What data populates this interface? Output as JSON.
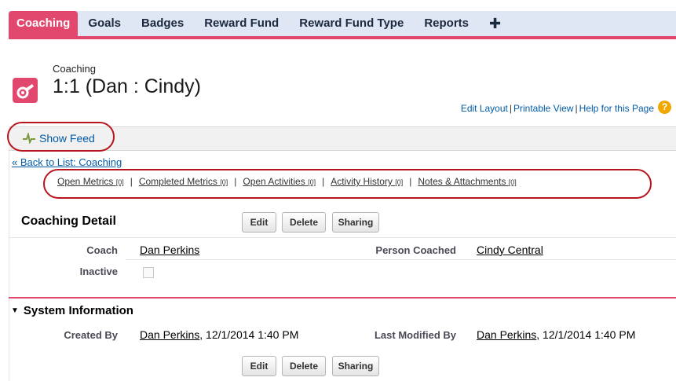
{
  "tabs": [
    {
      "label": "Coaching",
      "active": true
    },
    {
      "label": "Goals"
    },
    {
      "label": "Badges"
    },
    {
      "label": "Reward Fund"
    },
    {
      "label": "Reward Fund Type"
    },
    {
      "label": "Reports"
    },
    {
      "label": "✚"
    }
  ],
  "header": {
    "object_label": "Coaching",
    "record_title": "1:1 (Dan : Cindy)",
    "icon": "whistle-icon"
  },
  "help_links": {
    "edit_layout": "Edit Layout",
    "printable_view": "Printable View",
    "help": "Help for this Page",
    "help_icon": "?"
  },
  "feed": {
    "label": "Show Feed",
    "icon": "feed-pulse-icon"
  },
  "back_link": "« Back to List: Coaching",
  "related_lists": [
    {
      "label": "Open Metrics",
      "count": "[0]"
    },
    {
      "label": "Completed Metrics",
      "count": "[0]"
    },
    {
      "label": "Open Activities",
      "count": "[0]"
    },
    {
      "label": "Activity History",
      "count": "[0]"
    },
    {
      "label": "Notes & Attachments",
      "count": "[0]"
    }
  ],
  "detail": {
    "title": "Coaching Detail",
    "buttons": {
      "edit": "Edit",
      "delete": "Delete",
      "sharing": "Sharing"
    },
    "fields": {
      "coach_label": "Coach",
      "coach_value": "Dan Perkins",
      "person_coached_label": "Person Coached",
      "person_coached_value": "Cindy Central",
      "inactive_label": "Inactive",
      "inactive_checked": false
    }
  },
  "system_info": {
    "title": "System Information",
    "created_by_label": "Created By",
    "created_by_user": "Dan Perkins",
    "created_by_date": ", 12/1/2014 1:40 PM",
    "last_modified_label": "Last Modified By",
    "last_modified_user": "Dan Perkins",
    "last_modified_date": ", 12/1/2014 1:40 PM"
  },
  "colors": {
    "accent": "#e2476e",
    "tab_bg": "#dfe7f4",
    "link": "#015ba7",
    "annotation_red": "#b8141c"
  }
}
